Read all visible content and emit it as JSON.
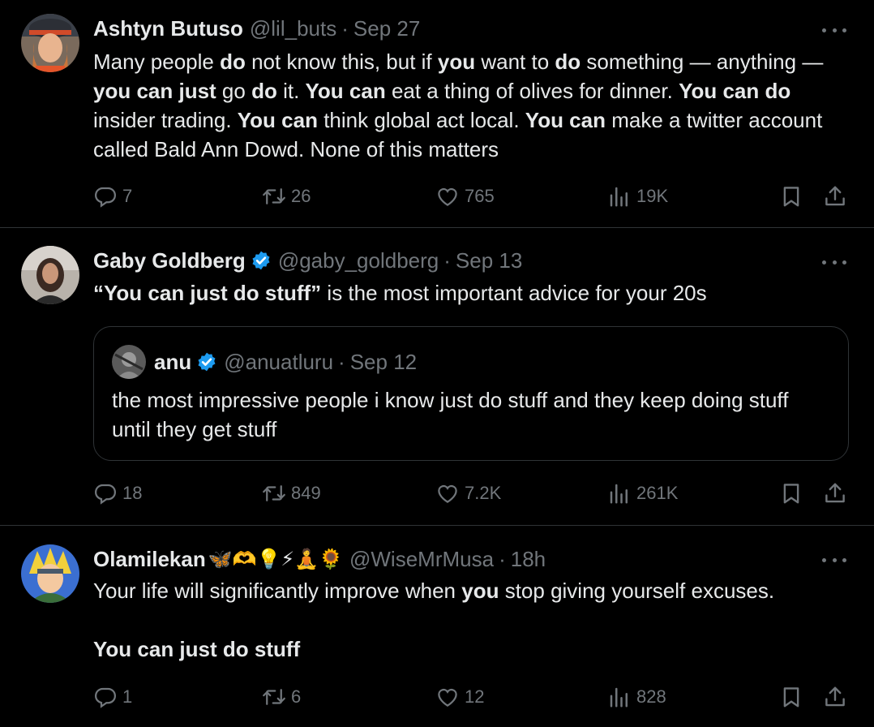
{
  "tweets": [
    {
      "name": "Ashtyn Butuso",
      "handle": "@lil_buts",
      "sep": "·",
      "time": "Sep 27",
      "text_html": "Many people <b>do</b> not know this, but if <b>you</b> want to <b>do</b> something — anything — <b>you can just</b> go <b>do</b> it. <b>You can</b> eat a thing of olives for dinner. <b>You can do</b> insider trading. <b>You can</b> think global act local. <b>You can</b> make a twitter account called Bald Ann Dowd. None of this matters",
      "replies": "7",
      "retweets": "26",
      "likes": "765",
      "views": "19K"
    },
    {
      "name": "Gaby Goldberg",
      "handle": "@gaby_goldberg",
      "sep": "·",
      "time": "Sep 13",
      "text_html": "<b>“You can just do stuff”</b> is the most important advice for your 20s",
      "quote": {
        "name": "anu",
        "handle": "@anuatluru",
        "sep": "·",
        "time": "Sep 12",
        "text": "the most impressive people i know just do stuff and they keep doing stuff until they get stuff"
      },
      "replies": "18",
      "retweets": "849",
      "likes": "7.2K",
      "views": "261K"
    },
    {
      "name": "Olamilekan",
      "name_emoji": "🦋🫶💡⚡🧘🌻",
      "handle": "@WiseMrMusa",
      "sep": "·",
      "time": "18h",
      "text_html": "Your life will significantly improve when <b>you</b> stop giving yourself excuses.<br><br><b>You can just do stuff</b>",
      "replies": "1",
      "retweets": "6",
      "likes": "12",
      "views": "828"
    }
  ],
  "icons": {
    "reply": "reply-icon",
    "retweet": "retweet-icon",
    "like": "heart-icon",
    "views": "views-icon",
    "bookmark": "bookmark-icon",
    "share": "share-icon",
    "more": "more-icon",
    "verified": "verified-badge-icon"
  },
  "colors": {
    "background": "#000000",
    "text": "#e7e9ea",
    "muted": "#71767b",
    "border": "#2f3336",
    "verified": "#1d9bf0"
  }
}
